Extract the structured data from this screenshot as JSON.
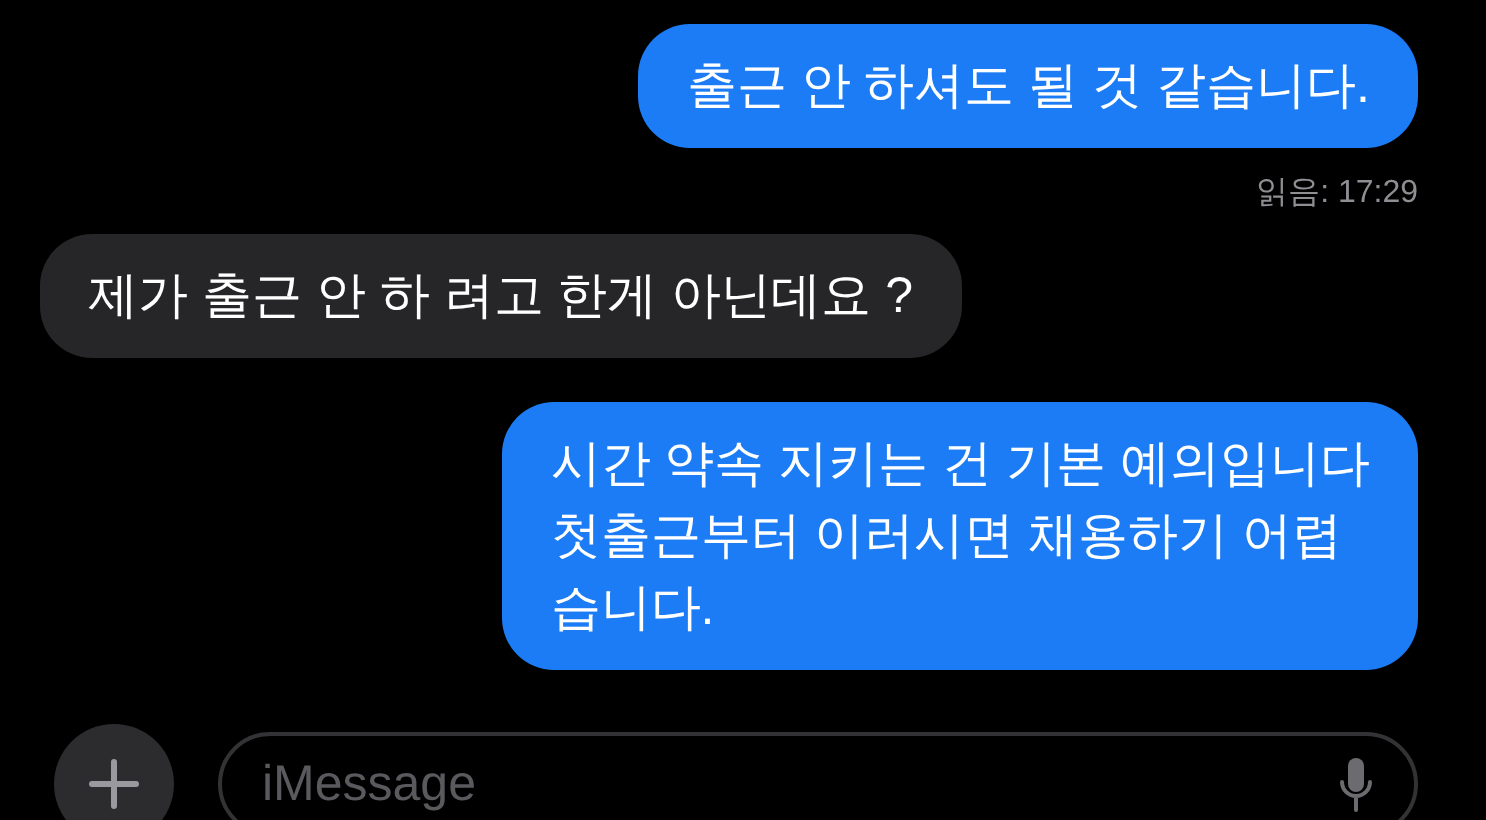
{
  "messages": [
    {
      "kind": "sent",
      "text": "출근 안 하셔도 될 것 같습니다."
    },
    {
      "kind": "receipt",
      "text": "읽음: 17:29"
    },
    {
      "kind": "received",
      "text": "제가 출근 안 하 려고 한게 아닌데요 ?"
    },
    {
      "kind": "sent",
      "text": "시간 약속 지키는 건 기본 예의입니다\n첫출근부터 이러시면 채용하기 어렵\n습니다."
    }
  ],
  "composer": {
    "placeholder": "iMessage"
  }
}
